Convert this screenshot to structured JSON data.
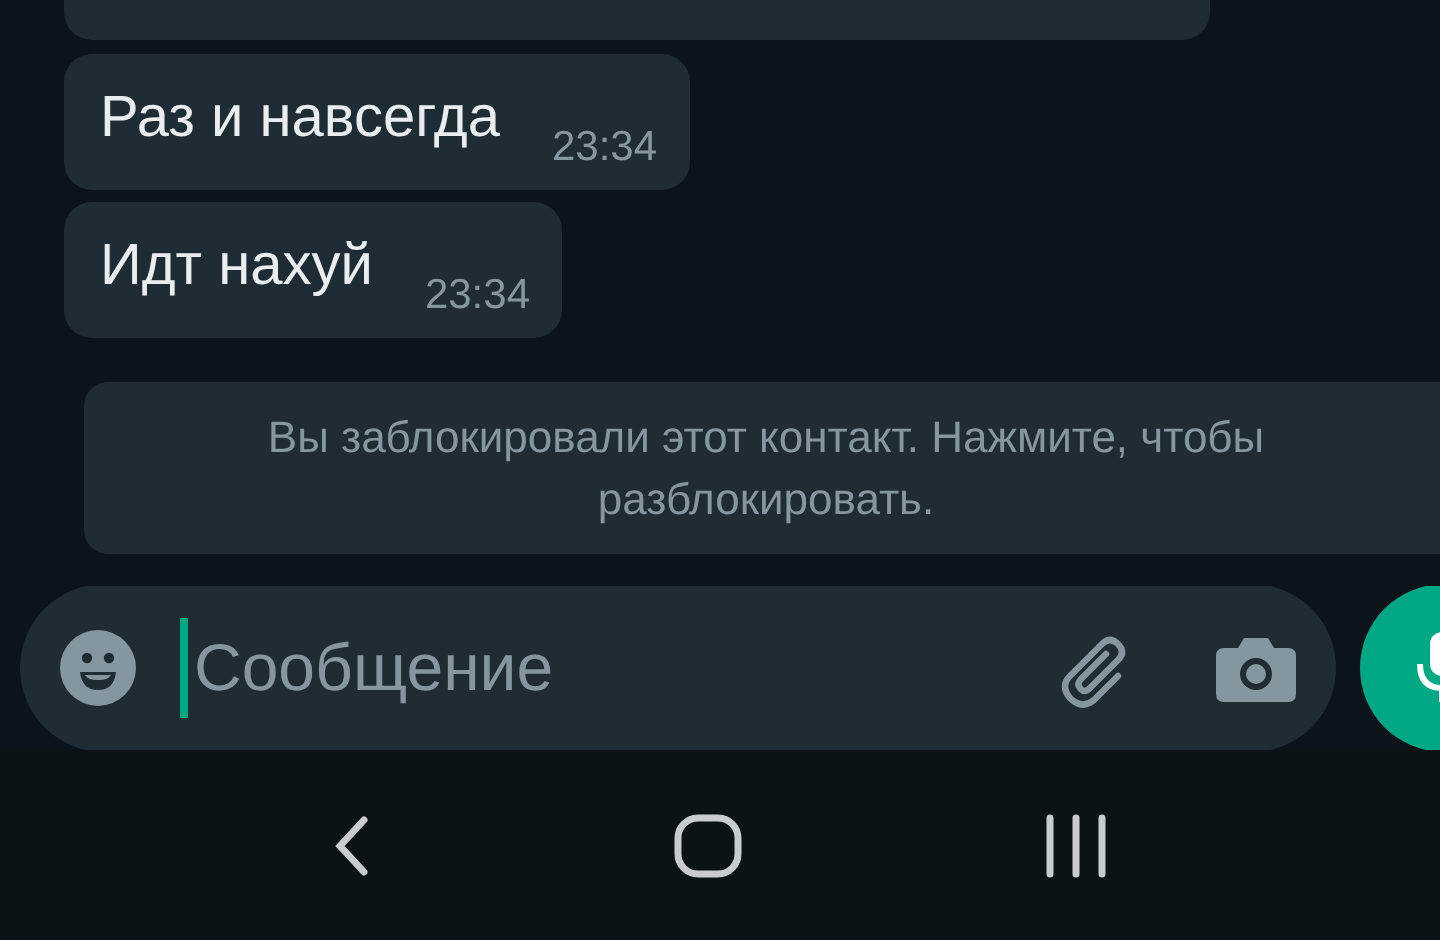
{
  "messages": [
    {
      "text": "Раз и навсегда",
      "time": "23:34"
    },
    {
      "text": "Идт нахуй",
      "time": "23:34"
    }
  ],
  "notice": "Вы заблокировали этот контакт. Нажмите, чтобы разблокировать.",
  "composer": {
    "placeholder": "Сообщение"
  }
}
